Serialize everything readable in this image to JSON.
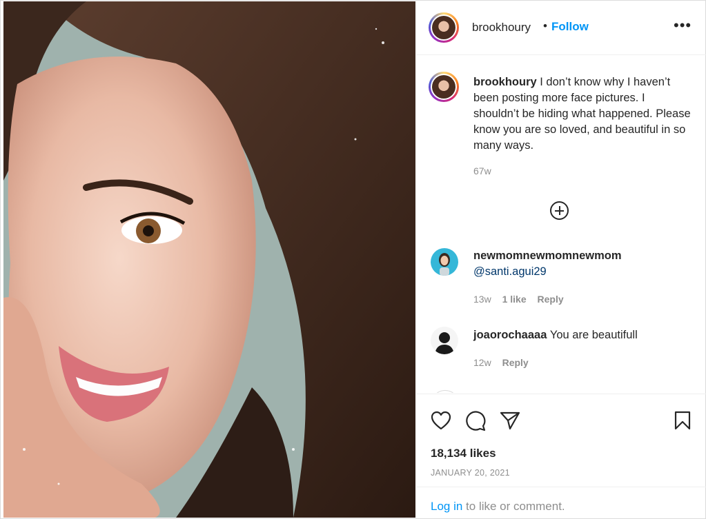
{
  "post": {
    "username": "brookhoury",
    "separator": "•",
    "follow_label": "Follow",
    "more_icon": "more-options-icon",
    "caption": "I don’t know why I haven’t been posting more face pictures. I shouldn’t be hiding what happened. Please know you are so loved, and beautiful in so many ways.",
    "caption_time": "67w",
    "load_more_icon": "plus-circle-icon"
  },
  "comments": [
    {
      "username": "newmomnewmomnewmom",
      "text": "@santi.agui29",
      "time": "13w",
      "likes": "1 like",
      "reply": "Reply"
    },
    {
      "username": "joaorochaaaa",
      "text": "You are beautifull",
      "time": "12w",
      "reply": "Reply"
    }
  ],
  "actions": {
    "like_icon": "heart-icon",
    "comment_icon": "comment-icon",
    "share_icon": "share-icon",
    "save_icon": "bookmark-icon",
    "likes_count": "18,134 likes",
    "date": "JANUARY 20, 2021"
  },
  "login": {
    "link": "Log in",
    "rest": " to like or comment."
  },
  "colors": {
    "link_blue": "#0095f6",
    "mention_blue": "#00376b",
    "muted": "#8e8e8e",
    "text": "#262626"
  }
}
